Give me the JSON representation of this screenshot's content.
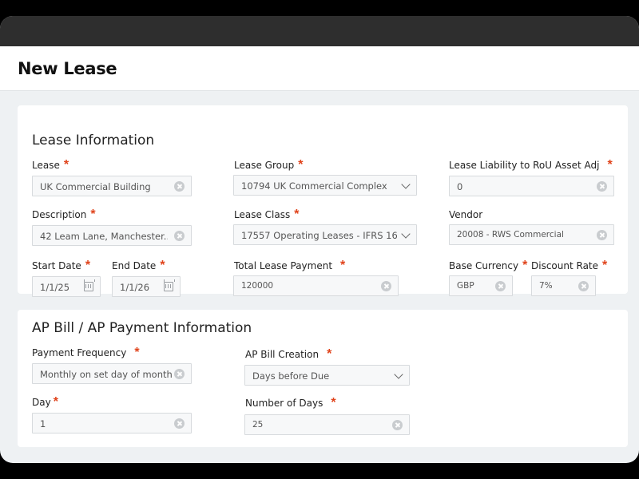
{
  "page": {
    "title": "New Lease"
  },
  "lease_info": {
    "heading": "Lease Information",
    "lease": {
      "label": "Lease",
      "value": "UK Commercial Building"
    },
    "lease_group": {
      "label": "Lease Group",
      "value": "10794  UK Commercial Complex"
    },
    "liability_adj": {
      "label": "Lease Liability to RoU Asset Adj",
      "value": "0"
    },
    "description": {
      "label": "Description",
      "value": "42 Leam Lane, Manchester..."
    },
    "lease_class": {
      "label": "Lease Class",
      "value": "17557 Operating Leases - IFRS 16"
    },
    "vendor": {
      "label": "Vendor",
      "value": "20008 - RWS Commercial"
    },
    "start_date": {
      "label": "Start Date",
      "value": "1/1/25"
    },
    "end_date": {
      "label": "End Date",
      "value": "1/1/26"
    },
    "total_payment": {
      "label": "Total Lease Payment",
      "value": "120000"
    },
    "base_currency": {
      "label": "Base Currency",
      "value": "GBP"
    },
    "discount_rate": {
      "label": "Discount Rate",
      "value": "7%"
    }
  },
  "ap_info": {
    "heading": "AP Bill / AP Payment Information",
    "payment_frequency": {
      "label": "Payment Frequency",
      "value": "Monthly on set day of month"
    },
    "ap_bill_creation": {
      "label": "AP Bill Creation",
      "value": "Days before Due"
    },
    "day": {
      "label": "Day",
      "value": "1"
    },
    "number_of_days": {
      "label": "Number of Days",
      "value": "25"
    }
  },
  "required_marker": "*"
}
